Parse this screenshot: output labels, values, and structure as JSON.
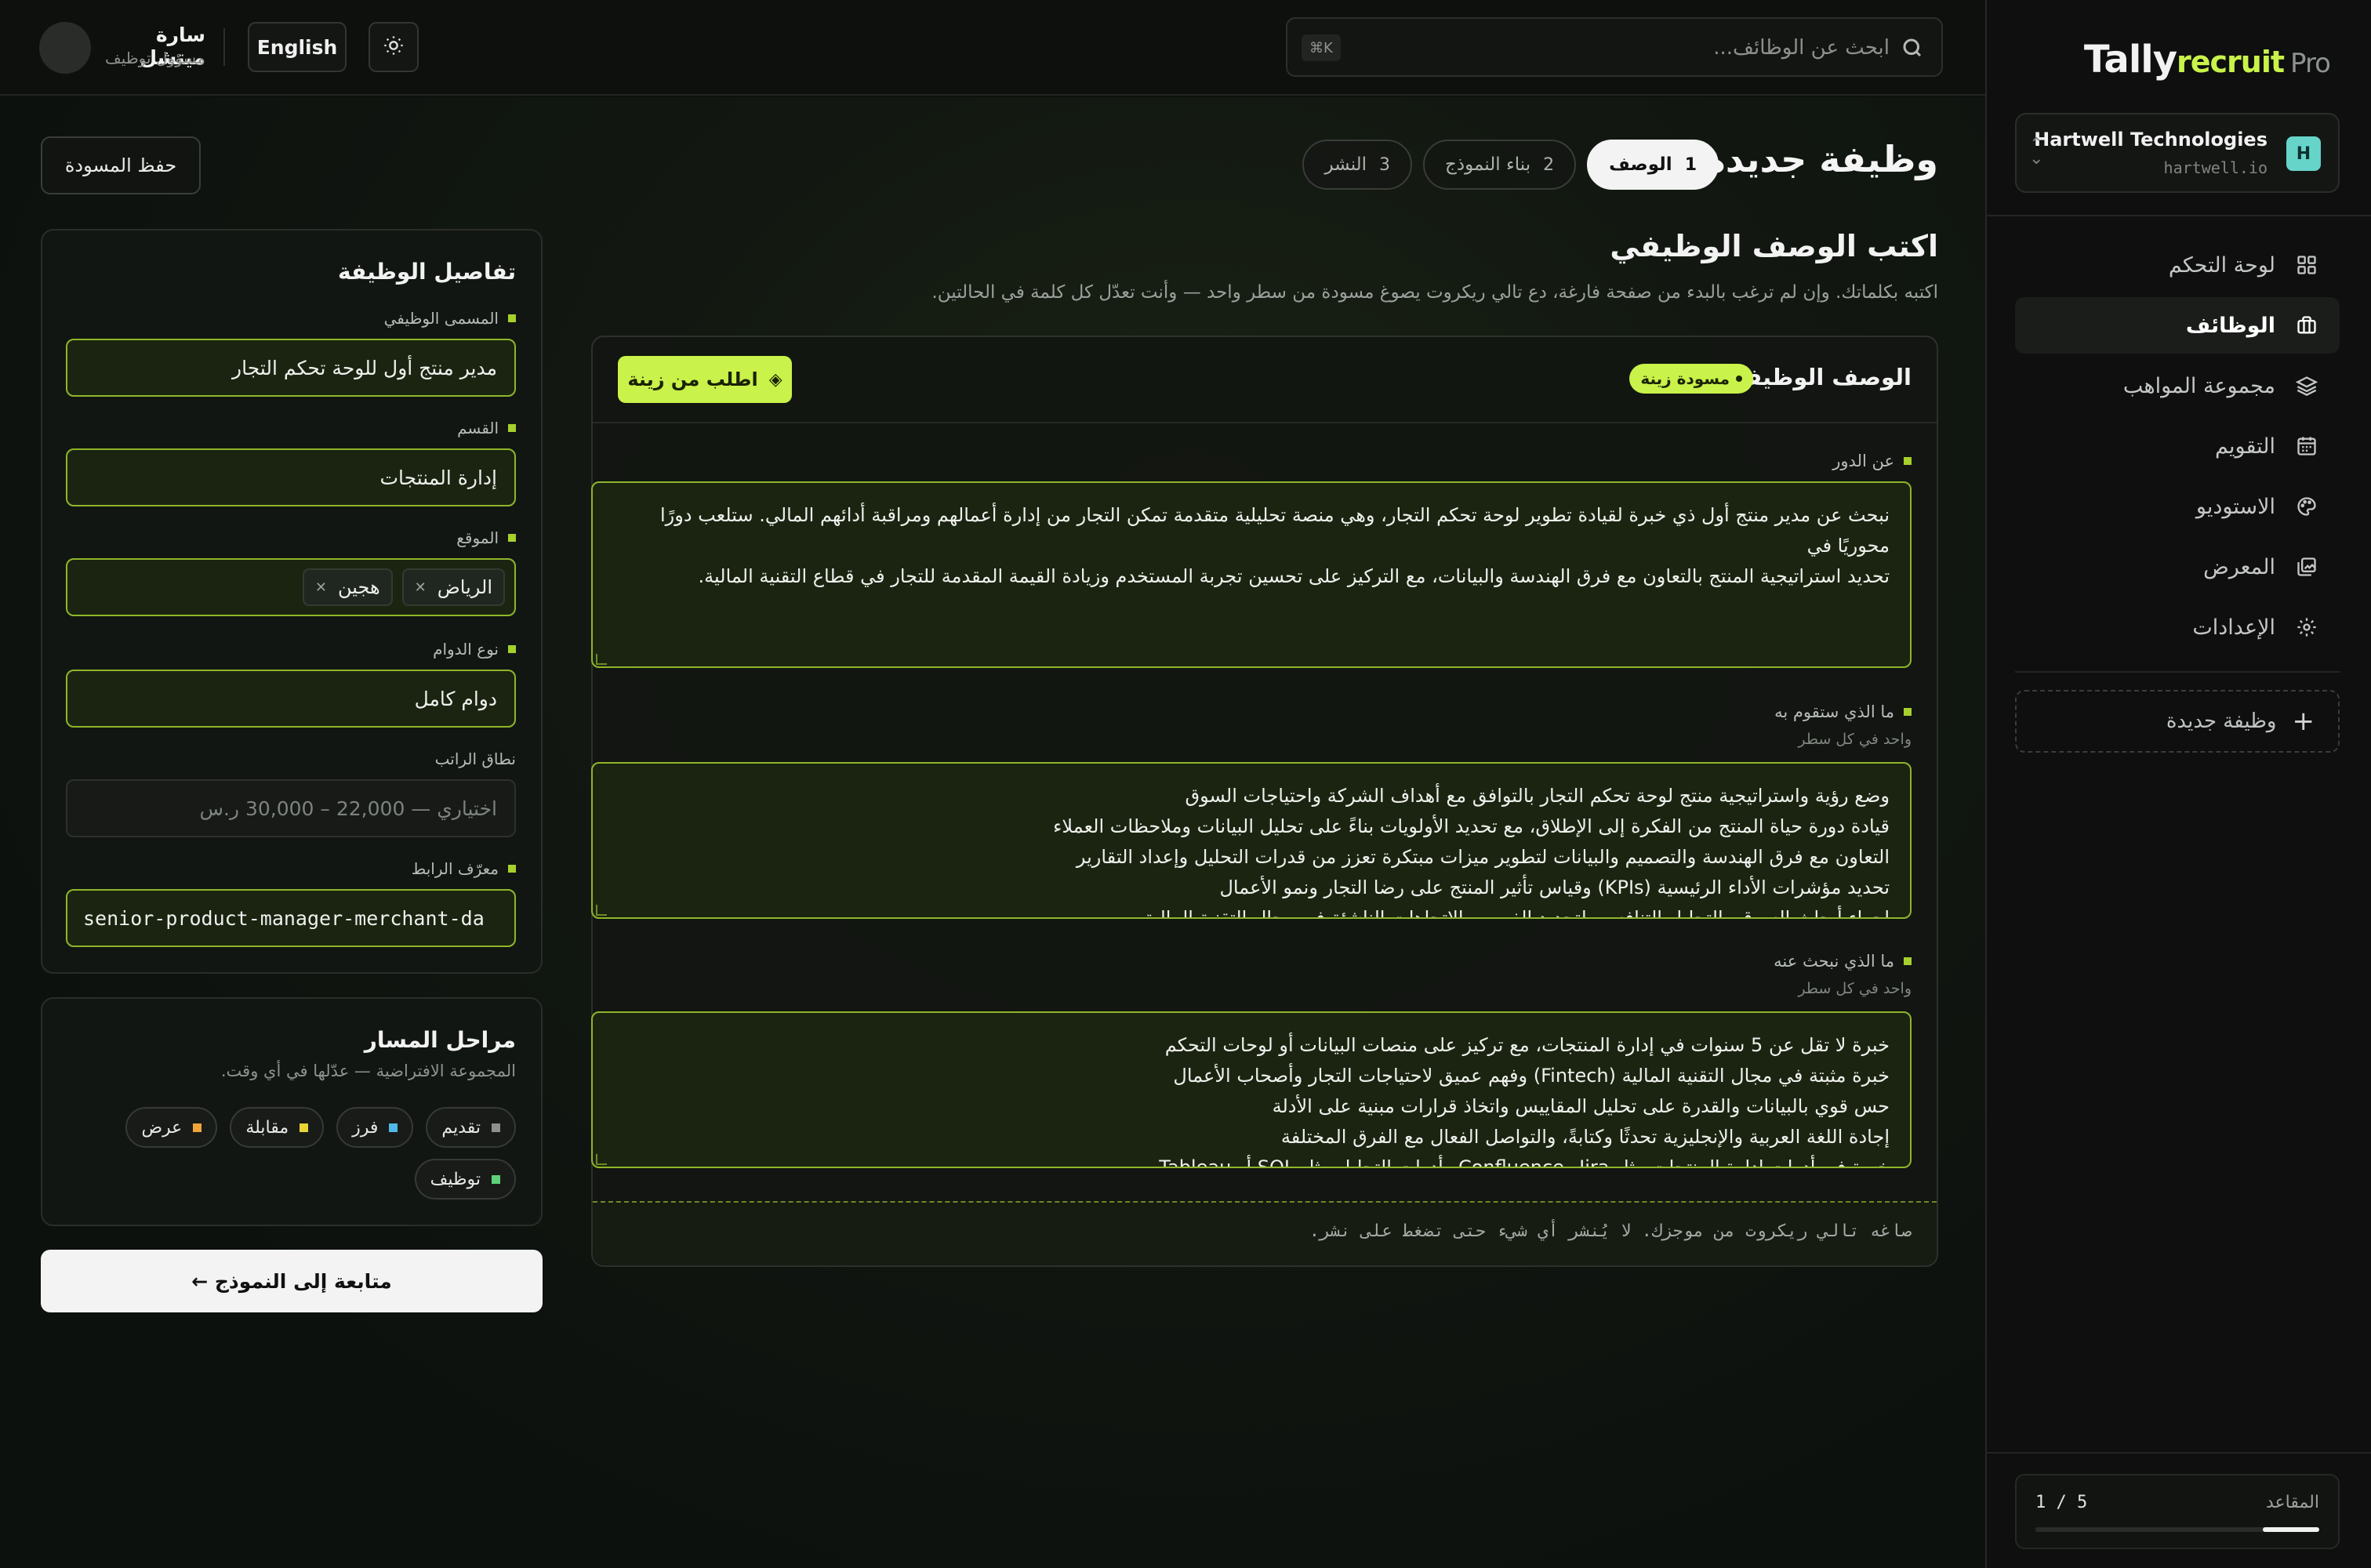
{
  "app": {
    "logo_part1": "Tally",
    "logo_part2": "recruit",
    "logo_part3": "Pro"
  },
  "org": {
    "badge": "H",
    "name": "Hartwell Technologies",
    "domain": "hartwell.io"
  },
  "nav": {
    "items": [
      {
        "label": "لوحة التحكم",
        "icon": "dashboard-grid-icon"
      },
      {
        "label": "الوظائف",
        "icon": "briefcase-icon",
        "active": true
      },
      {
        "label": "مجموعة المواهب",
        "icon": "layers-icon"
      },
      {
        "label": "التقويم",
        "icon": "calendar-icon"
      },
      {
        "label": "الاستوديو",
        "icon": "palette-icon"
      },
      {
        "label": "المعرض",
        "icon": "gallery-icon"
      },
      {
        "label": "الإعدادات",
        "icon": "gear-icon"
      }
    ],
    "new_job": "وظيفة جديدة"
  },
  "seats": {
    "label": "المقاعد",
    "count": "1 / 5",
    "used": 1,
    "total": 5
  },
  "topbar": {
    "search_placeholder": "ابحث عن الوظائف...",
    "shortcut": "⌘K",
    "language": "English",
    "user_name": "سارة ميتشل",
    "user_role": "مسؤول توظيف"
  },
  "page": {
    "title": "وظيفة جديدة",
    "save_draft": "حفظ المسودة",
    "steps": [
      {
        "num": "1",
        "label": "الوصف",
        "active": true
      },
      {
        "num": "2",
        "label": "بناء النموذج",
        "active": false
      },
      {
        "num": "3",
        "label": "النشر",
        "active": false
      }
    ],
    "section_title": "اكتب الوصف الوظيفي",
    "section_sub": "اكتبه بكلماتك. وإن لم ترغب بالبدء من صفحة فارغة، دع تالي ريكروت يصوغ مسودة من سطر واحد — وأنت تعدّل كل كلمة في الحالتين."
  },
  "description": {
    "title": "الوصف الوظيفي",
    "draft_badge": "مسودة زينة",
    "ask_button": "اطلب من زينة",
    "about_label": "عن الدور",
    "about_lines": [
      "نبحث عن مدير منتج أول ذي خبرة لقيادة تطوير لوحة تحكم التجار، وهي منصة تحليلية متقدمة تمكن التجار من إدارة أعمالهم ومراقبة أدائهم المالي. ستلعب دورًا محوريًا في",
      "تحديد استراتيجية المنتج بالتعاون مع فرق الهندسة والبيانات، مع التركيز على تحسين تجربة المستخدم وزيادة القيمة المقدمة للتجار في قطاع التقنية المالية."
    ],
    "duties_label": "ما الذي ستقوم به",
    "duties_hint": "واحد في كل سطر",
    "duties_lines": [
      "وضع رؤية واستراتيجية منتج لوحة تحكم التجار بالتوافق مع أهداف الشركة واحتياجات السوق",
      "قيادة دورة حياة المنتج من الفكرة إلى الإطلاق، مع تحديد الأولويات بناءً على تحليل البيانات وملاحظات العملاء",
      "التعاون مع فرق الهندسة والتصميم والبيانات لتطوير ميزات مبتكرة تعزز من قدرات التحليل وإعداد التقارير",
      "تحديد مؤشرات الأداء الرئيسية (KPIs) وقياس تأثير المنتج على رضا التجار ونمو الأعمال",
      "إجراء أبحاث السوق والتحليل التنافسي لتحديد الفرص والاتجاهات الناشئة في مجال التقنية المالية"
    ],
    "req_label": "ما الذي نبحث عنه",
    "req_hint": "واحد في كل سطر",
    "req_lines": [
      "خبرة لا تقل عن 5 سنوات في إدارة المنتجات، مع تركيز على منصات البيانات أو لوحات التحكم",
      "خبرة مثبتة في مجال التقنية المالية (Fintech) وفهم عميق لاحتياجات التجار وأصحاب الأعمال",
      "حس قوي بالبيانات والقدرة على تحليل المقاييس واتخاذ قرارات مبنية على الأدلة",
      "إجادة اللغة العربية والإنجليزية تحدثًا وكتابةً، والتواصل الفعال مع الفرق المختلفة",
      "خبرة في أدوات إدارة المنتجات مثل Jira وConfluence وأدوات التحليل مثل SQL أو Tableau"
    ],
    "footer_note": "صاغه تالي ريكروت من موجزك. لا يُنشر أي شيء حتى تضغط على نشر."
  },
  "details": {
    "title": "تفاصيل الوظيفة",
    "job_title_label": "المسمى الوظيفي",
    "job_title_value": "مدير منتج أول للوحة تحكم التجار",
    "department_label": "القسم",
    "department_value": "إدارة المنتجات",
    "location_label": "الموقع",
    "locations": [
      "الرياض",
      "هجين"
    ],
    "employment_label": "نوع الدوام",
    "employment_value": "دوام كامل",
    "salary_label": "نطاق الراتب",
    "salary_placeholder": "اختياري — 22,000 – 30,000 ر.س",
    "slug_label": "معرّف الرابط",
    "slug_value": "senior-product-manager-merchant-da"
  },
  "stages": {
    "title": "مراحل المسار",
    "subtitle": "المجموعة الافتراضية — عدّلها في أي وقت.",
    "items": [
      {
        "label": "تقديم",
        "color": "#8c918d"
      },
      {
        "label": "فرز",
        "color": "#4fb8e8"
      },
      {
        "label": "مقابلة",
        "color": "#e6d534"
      },
      {
        "label": "عرض",
        "color": "#f0a53a"
      },
      {
        "label": "توظيف",
        "color": "#5fd07a"
      }
    ]
  },
  "continue_button": "متابعة إلى النموذج ←",
  "colors": {
    "accent": "#c9f24a",
    "background": "#0d110e",
    "field_border": "#8fb52a"
  }
}
